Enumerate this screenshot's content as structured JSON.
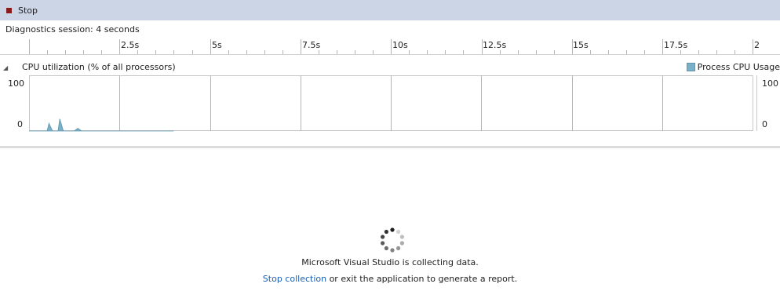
{
  "toolbar": {
    "stop_label": "Stop"
  },
  "session": {
    "label": "Diagnostics session: 4 seconds"
  },
  "timeline": {
    "unit": "s",
    "tick_labels": [
      "2.5s",
      "5s",
      "7.5s",
      "10s",
      "12.5s",
      "15s",
      "17.5s",
      "2"
    ]
  },
  "cpu_section": {
    "title": "CPU utilization (% of all processors)",
    "legend_label": "Process CPU Usage",
    "legend_color": "#7ab1c8",
    "y_max_label": "100",
    "y_min_label": "0",
    "y_max_label_right": "100",
    "y_min_label_right": "0"
  },
  "chart_data": {
    "type": "area",
    "series": [
      {
        "name": "Process CPU Usage",
        "x": [
          0.0,
          0.4,
          0.5,
          0.55,
          0.65,
          0.72,
          0.8,
          0.85,
          0.95,
          1.15,
          1.25,
          1.35,
          1.45,
          1.55,
          2.5,
          4.0
        ],
        "y": [
          0,
          0,
          0,
          14,
          0,
          0,
          0,
          22,
          0,
          0,
          0,
          5,
          0,
          0,
          0,
          0
        ]
      }
    ],
    "xlim": [
      0,
      20
    ],
    "ylim": [
      0,
      100
    ],
    "xlabel": "",
    "ylabel": "",
    "grid": true
  },
  "status": {
    "collecting_text": "Microsoft Visual Studio is collecting data.",
    "stop_link": "Stop collection",
    "rest_text": " or exit the application to generate a report."
  },
  "icons": {
    "stop": "stop-square-icon",
    "collapse": "collapse-triangle-icon",
    "spinner": "loading-spinner-icon"
  }
}
